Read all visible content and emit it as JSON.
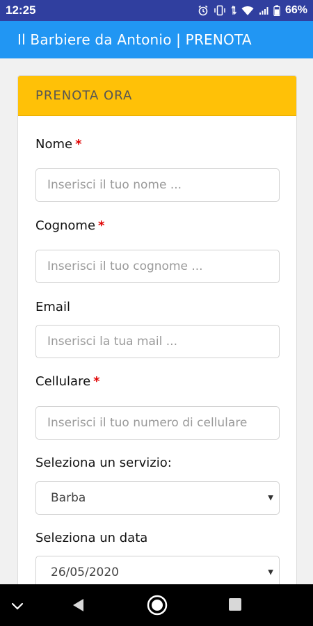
{
  "status_bar": {
    "time": "12:25",
    "icons": [
      "alarm-icon",
      "vibrate-icon",
      "data-arrows-icon",
      "wifi-icon",
      "signal-icon",
      "battery-icon"
    ],
    "battery": "66%"
  },
  "app_bar": {
    "title": "Il Barbiere da Antonio | PRENOTA",
    "color": "#2196f3"
  },
  "form": {
    "header": "PRENOTA ORA",
    "header_color": "#ffc107",
    "required_mark": "*",
    "fields": {
      "nome": {
        "label": "Nome",
        "placeholder": "Inserisci il tuo nome ..."
      },
      "cognome": {
        "label": "Cognome",
        "placeholder": "Inserisci il tuo cognome ..."
      },
      "email": {
        "label": "Email",
        "placeholder": "Inserisci la tua mail ..."
      },
      "cellulare": {
        "label": "Cellulare",
        "placeholder": "Inserisci il tuo numero di cellulare"
      },
      "servizio": {
        "label": "Seleziona un servizio:",
        "value": "Barba"
      },
      "data": {
        "label": "Seleziona un data",
        "value": "26/05/2020"
      }
    }
  },
  "nav_bar": {
    "icons": [
      "chevron-down-icon",
      "back-icon",
      "home-icon",
      "recents-icon"
    ]
  }
}
